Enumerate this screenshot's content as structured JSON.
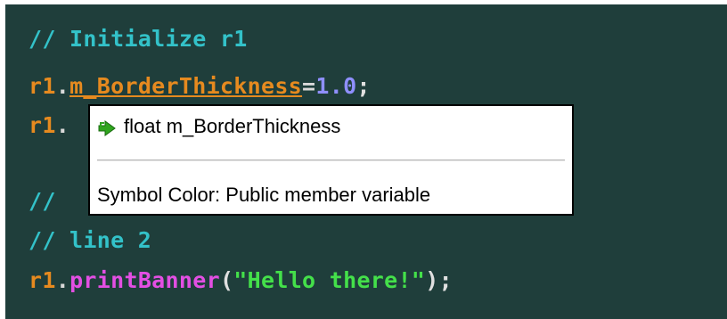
{
  "code": {
    "line1": {
      "comment": "// Initialize r1"
    },
    "line2": {
      "object": "r1",
      "dot": ".",
      "member": "m_BorderThickness",
      "assign": "=",
      "number": "1.0",
      "semicolon": ";"
    },
    "line3": {
      "object": "r1",
      "dot": "."
    },
    "line4": {
      "comment": "//"
    },
    "line5": {
      "comment": "// line 2"
    },
    "line6": {
      "object": "r1",
      "dot": ".",
      "method": "printBanner",
      "open_paren": "(",
      "string": "\"Hello there!\"",
      "close_paren": ")",
      "semicolon": ";"
    }
  },
  "tooltip": {
    "signature": "float m_BorderThickness",
    "description": "Symbol Color: Public member variable",
    "icon": "member-variable-icon"
  },
  "colors": {
    "background": "#1f3e3b",
    "comment": "#33c2c9",
    "identifier": "#e68a1f",
    "number": "#8f8fff",
    "method": "#e34fe3",
    "string": "#44e04a",
    "icon_green": "#2fa51e"
  }
}
